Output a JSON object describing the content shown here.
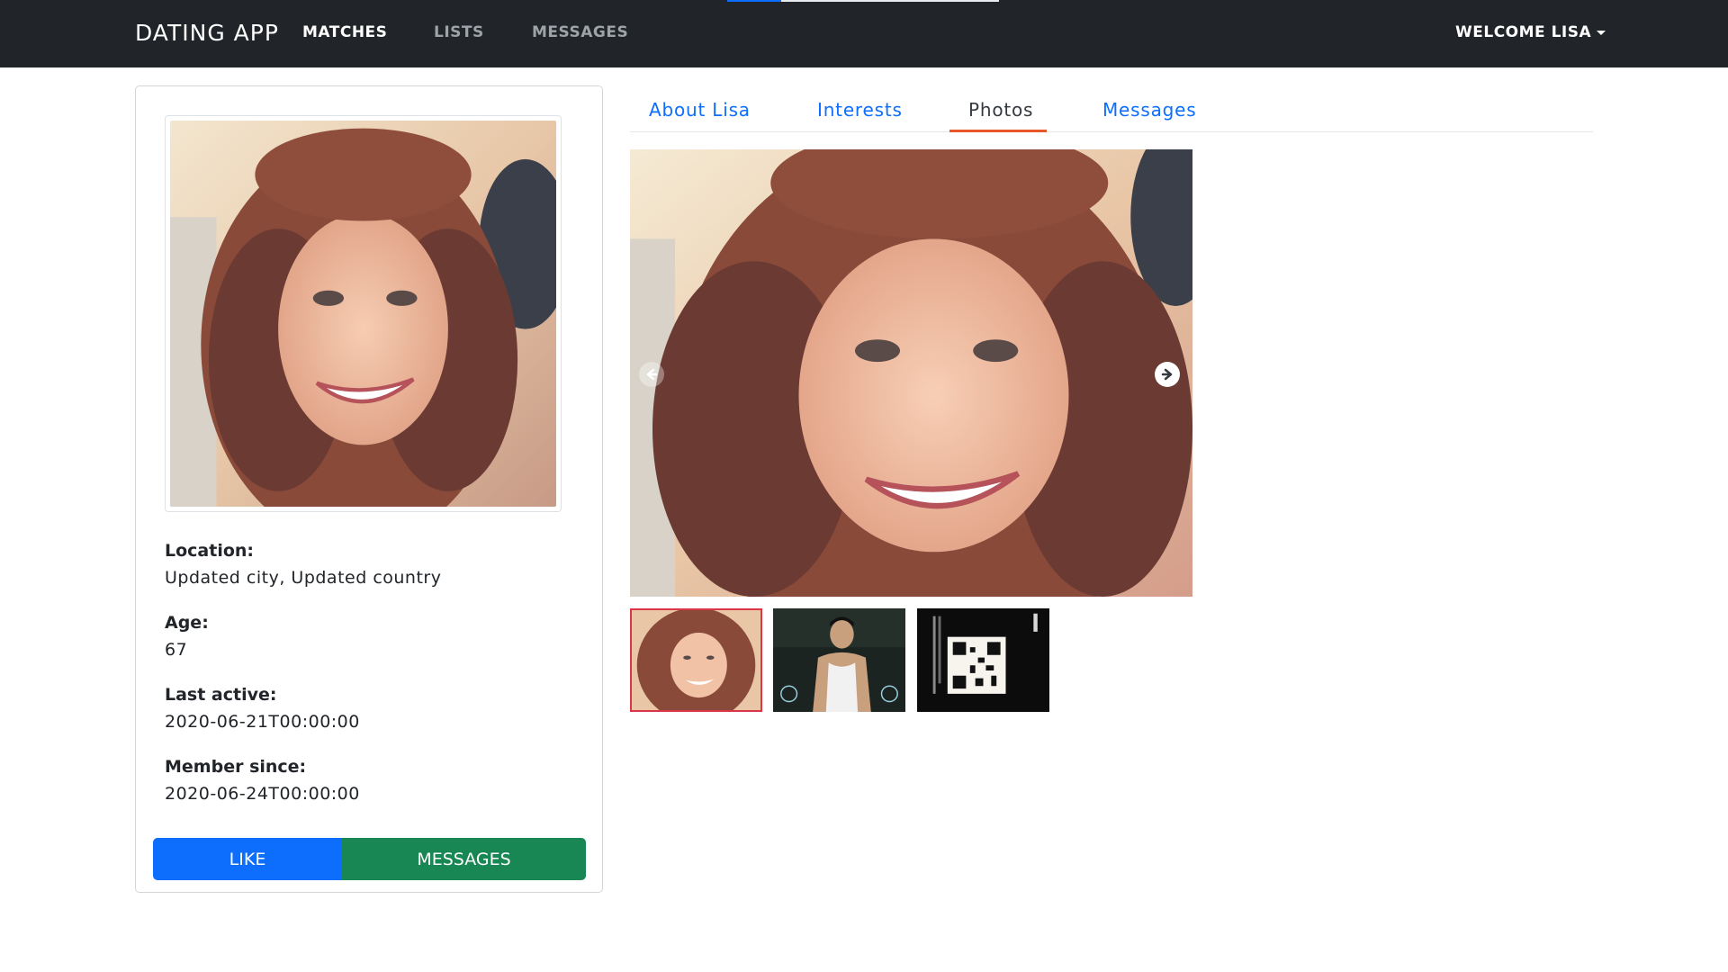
{
  "navbar": {
    "brand": "DATING APP",
    "links": [
      {
        "label": "MATCHES",
        "active": true
      },
      {
        "label": "LISTS",
        "active": false
      },
      {
        "label": "MESSAGES",
        "active": false
      }
    ],
    "user_menu": "WELCOME LISA",
    "progress": 0.2
  },
  "profile": {
    "fields": [
      {
        "label": "Location:",
        "value": "Updated city, Updated country"
      },
      {
        "label": "Age:",
        "value": "67"
      },
      {
        "label": "Last active:",
        "value": "2020-06-21T00:00:00"
      },
      {
        "label": "Member since:",
        "value": "2020-06-24T00:00:00"
      }
    ],
    "like_button": "LIKE",
    "messages_button": "MESSAGES"
  },
  "tabs": [
    {
      "label": "About Lisa",
      "active": false
    },
    {
      "label": "Interests",
      "active": false
    },
    {
      "label": "Photos",
      "active": true
    },
    {
      "label": "Messages",
      "active": false
    }
  ],
  "gallery": {
    "thumbnails": [
      {
        "subject": "woman-curly-hair",
        "selected": true
      },
      {
        "subject": "man-white-tank-top",
        "selected": false
      },
      {
        "subject": "qr-code-sign",
        "selected": false
      }
    ],
    "prev_icon": "arrow-left-circle-icon",
    "next_icon": "arrow-right-circle-icon"
  },
  "colors": {
    "navbar_bg": "#212529",
    "primary": "#0d6efd",
    "success": "#198754",
    "tab_active_underline": "#e8572a",
    "thumb_selected_border": "#dc3545"
  }
}
